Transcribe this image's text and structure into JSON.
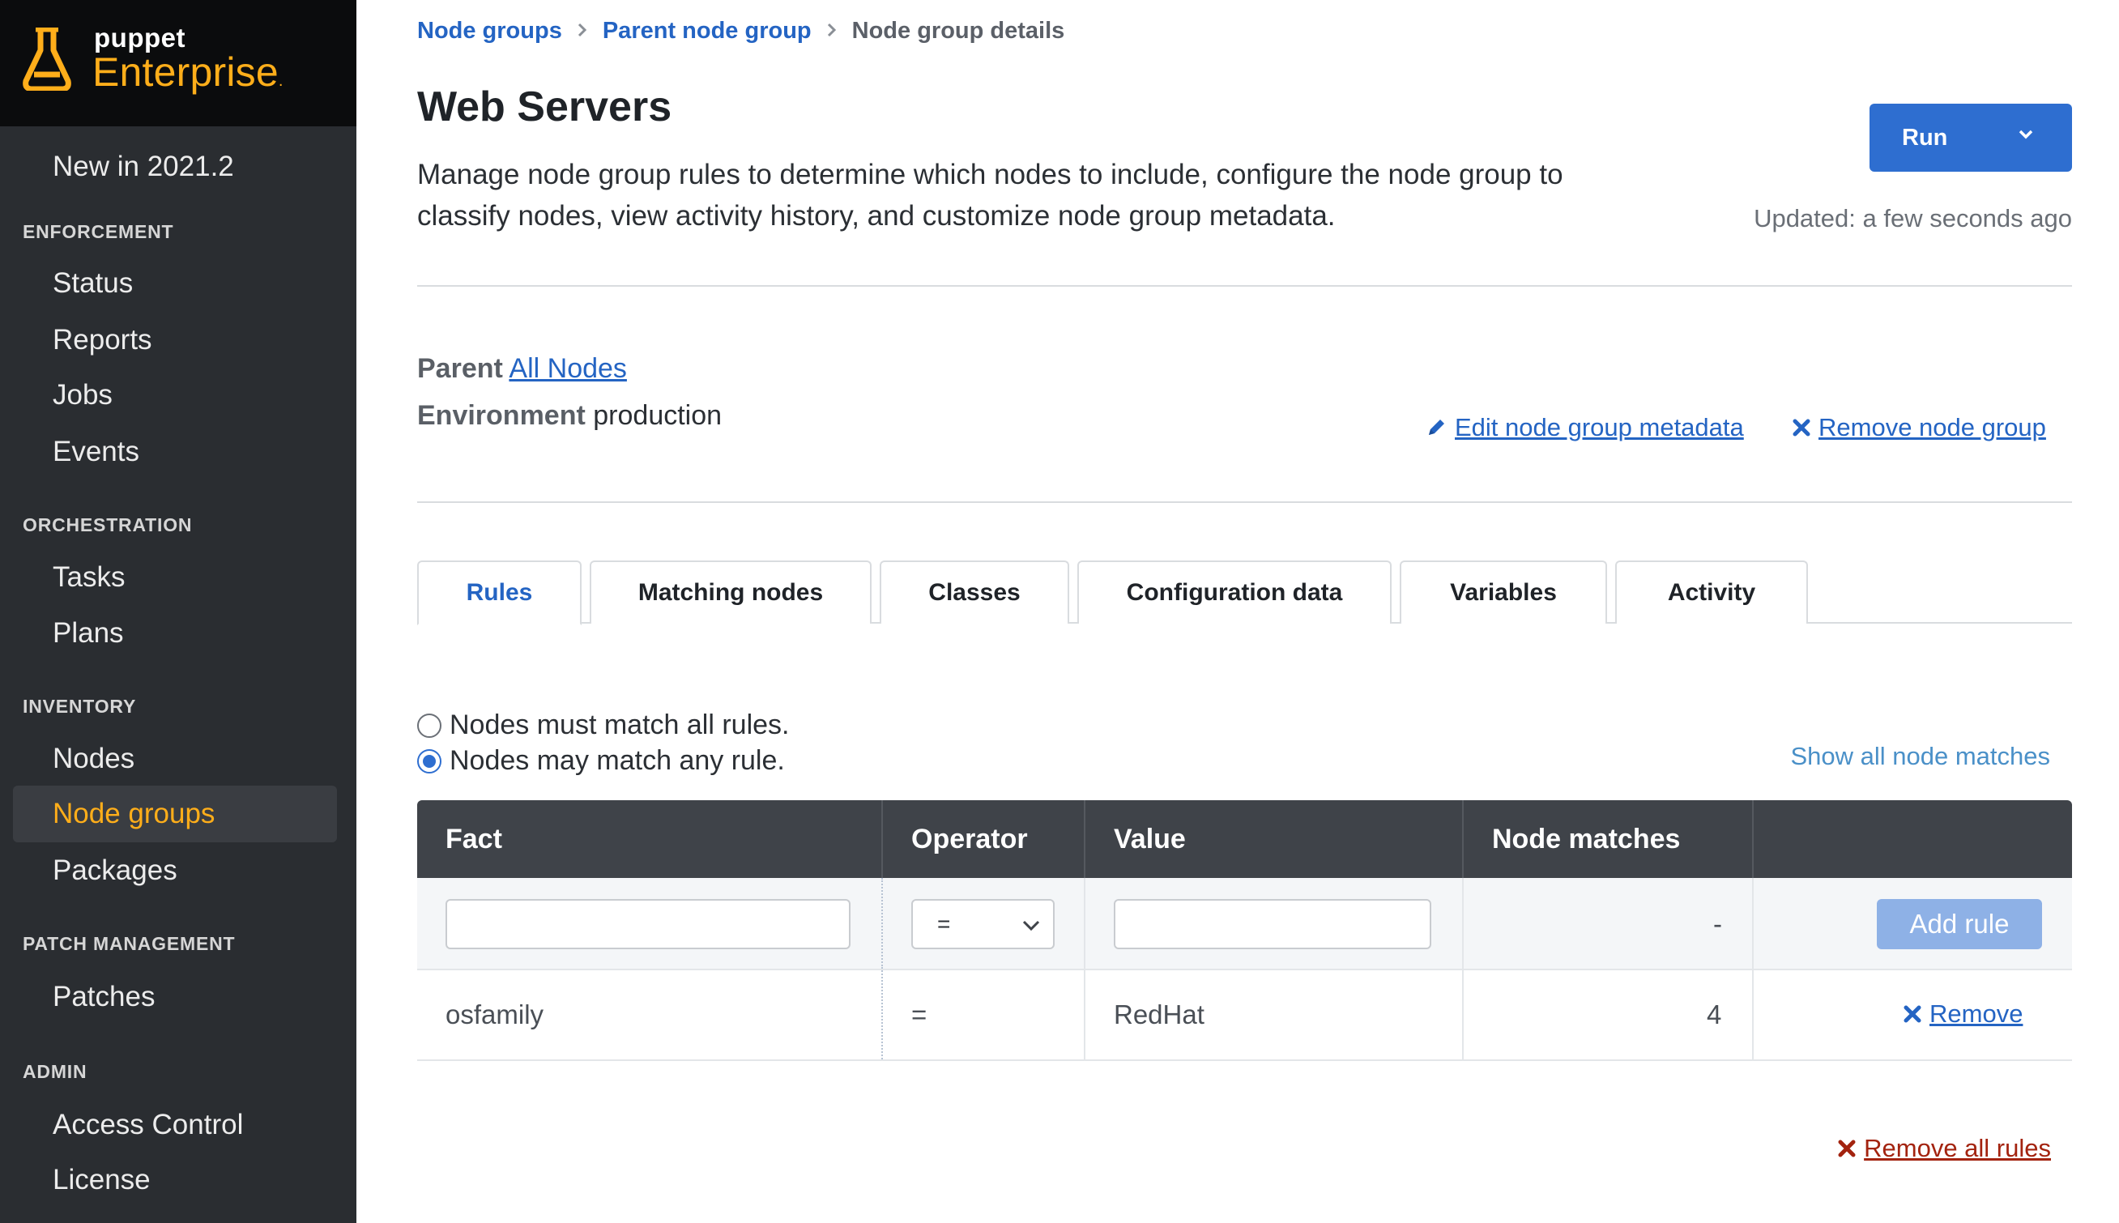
{
  "brand": {
    "top_line": "puppet",
    "product": "Enterprise",
    "accent_color": "#ffae1a"
  },
  "sidebar": {
    "whats_new": "New in 2021.2",
    "sections": [
      {
        "title": "ENFORCEMENT",
        "items": [
          "Status",
          "Reports",
          "Jobs",
          "Events"
        ]
      },
      {
        "title": "ORCHESTRATION",
        "items": [
          "Tasks",
          "Plans"
        ]
      },
      {
        "title": "INVENTORY",
        "items": [
          "Nodes",
          "Node groups",
          "Packages"
        ]
      },
      {
        "title": "PATCH MANAGEMENT",
        "items": [
          "Patches"
        ]
      },
      {
        "title": "ADMIN",
        "items": [
          "Access Control",
          "License"
        ]
      }
    ],
    "active_item": "Node groups"
  },
  "breadcrumb": {
    "items": [
      "Node groups",
      "Parent node group"
    ],
    "current": "Node group details"
  },
  "header": {
    "title": "Web Servers",
    "description": "Manage node group rules to determine which nodes to include, configure the node group to classify nodes, view activity history, and customize node group metadata.",
    "run_label": "Run",
    "updated": "Updated: a few seconds ago"
  },
  "meta": {
    "parent_label": "Parent",
    "parent_value": "All Nodes",
    "environment_label": "Environment",
    "environment_value": "production",
    "edit_label": "Edit node group metadata",
    "remove_label": "Remove node group"
  },
  "tabs": [
    "Rules",
    "Matching nodes",
    "Classes",
    "Configuration data",
    "Variables",
    "Activity"
  ],
  "active_tab": "Rules",
  "rules": {
    "match_all_label": "Nodes must match all rules.",
    "match_any_label": "Nodes may match any rule.",
    "selected_mode": "any",
    "show_matches": "Show all node matches",
    "columns": [
      "Fact",
      "Operator",
      "Value",
      "Node matches",
      ""
    ],
    "new_rule": {
      "fact_value": "",
      "operator_value": "=",
      "value_value": "",
      "node_matches": "-",
      "add_label": "Add rule"
    },
    "rows": [
      {
        "fact": "osfamily",
        "operator": "=",
        "value": "RedHat",
        "node_matches": "4",
        "action": "Remove"
      }
    ],
    "remove_all_label": "Remove all rules"
  }
}
